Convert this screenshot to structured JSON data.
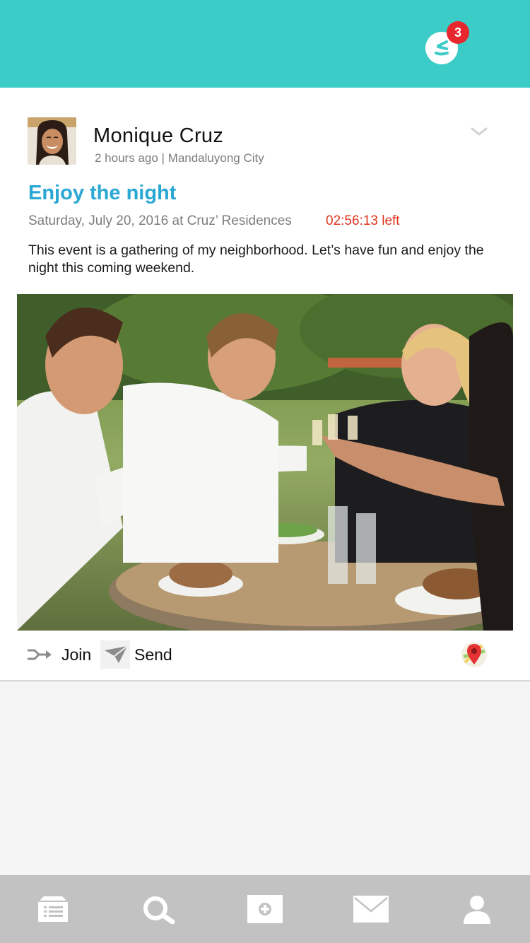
{
  "header": {
    "notification_count": "3",
    "logo_icon": "logo-icon",
    "colors": {
      "bar": "#3cccc8",
      "badge": "#e8262e"
    }
  },
  "post": {
    "author": "Monique Cruz",
    "time_location": "2 hours ago | Mandaluyong City",
    "menu_icon": "chevron-down-icon",
    "event": {
      "title": "Enjoy the night",
      "when_where": "Saturday, July 20, 2016 at Cruz’ Residences",
      "countdown": "02:56:13 left",
      "description": "This event is a gathering of my neighborhood. Let’s have fun and enjoy the night this coming weekend."
    },
    "actions": {
      "join_label": "Join",
      "send_label": "Send",
      "map_icon": "map-pin-icon"
    },
    "colors": {
      "title": "#2aa7d3",
      "countdown": "#e0351d"
    }
  },
  "bottom_nav": {
    "items": [
      {
        "icon": "feed-icon"
      },
      {
        "icon": "search-icon"
      },
      {
        "icon": "create-icon"
      },
      {
        "icon": "mail-icon"
      },
      {
        "icon": "profile-icon"
      }
    ]
  }
}
